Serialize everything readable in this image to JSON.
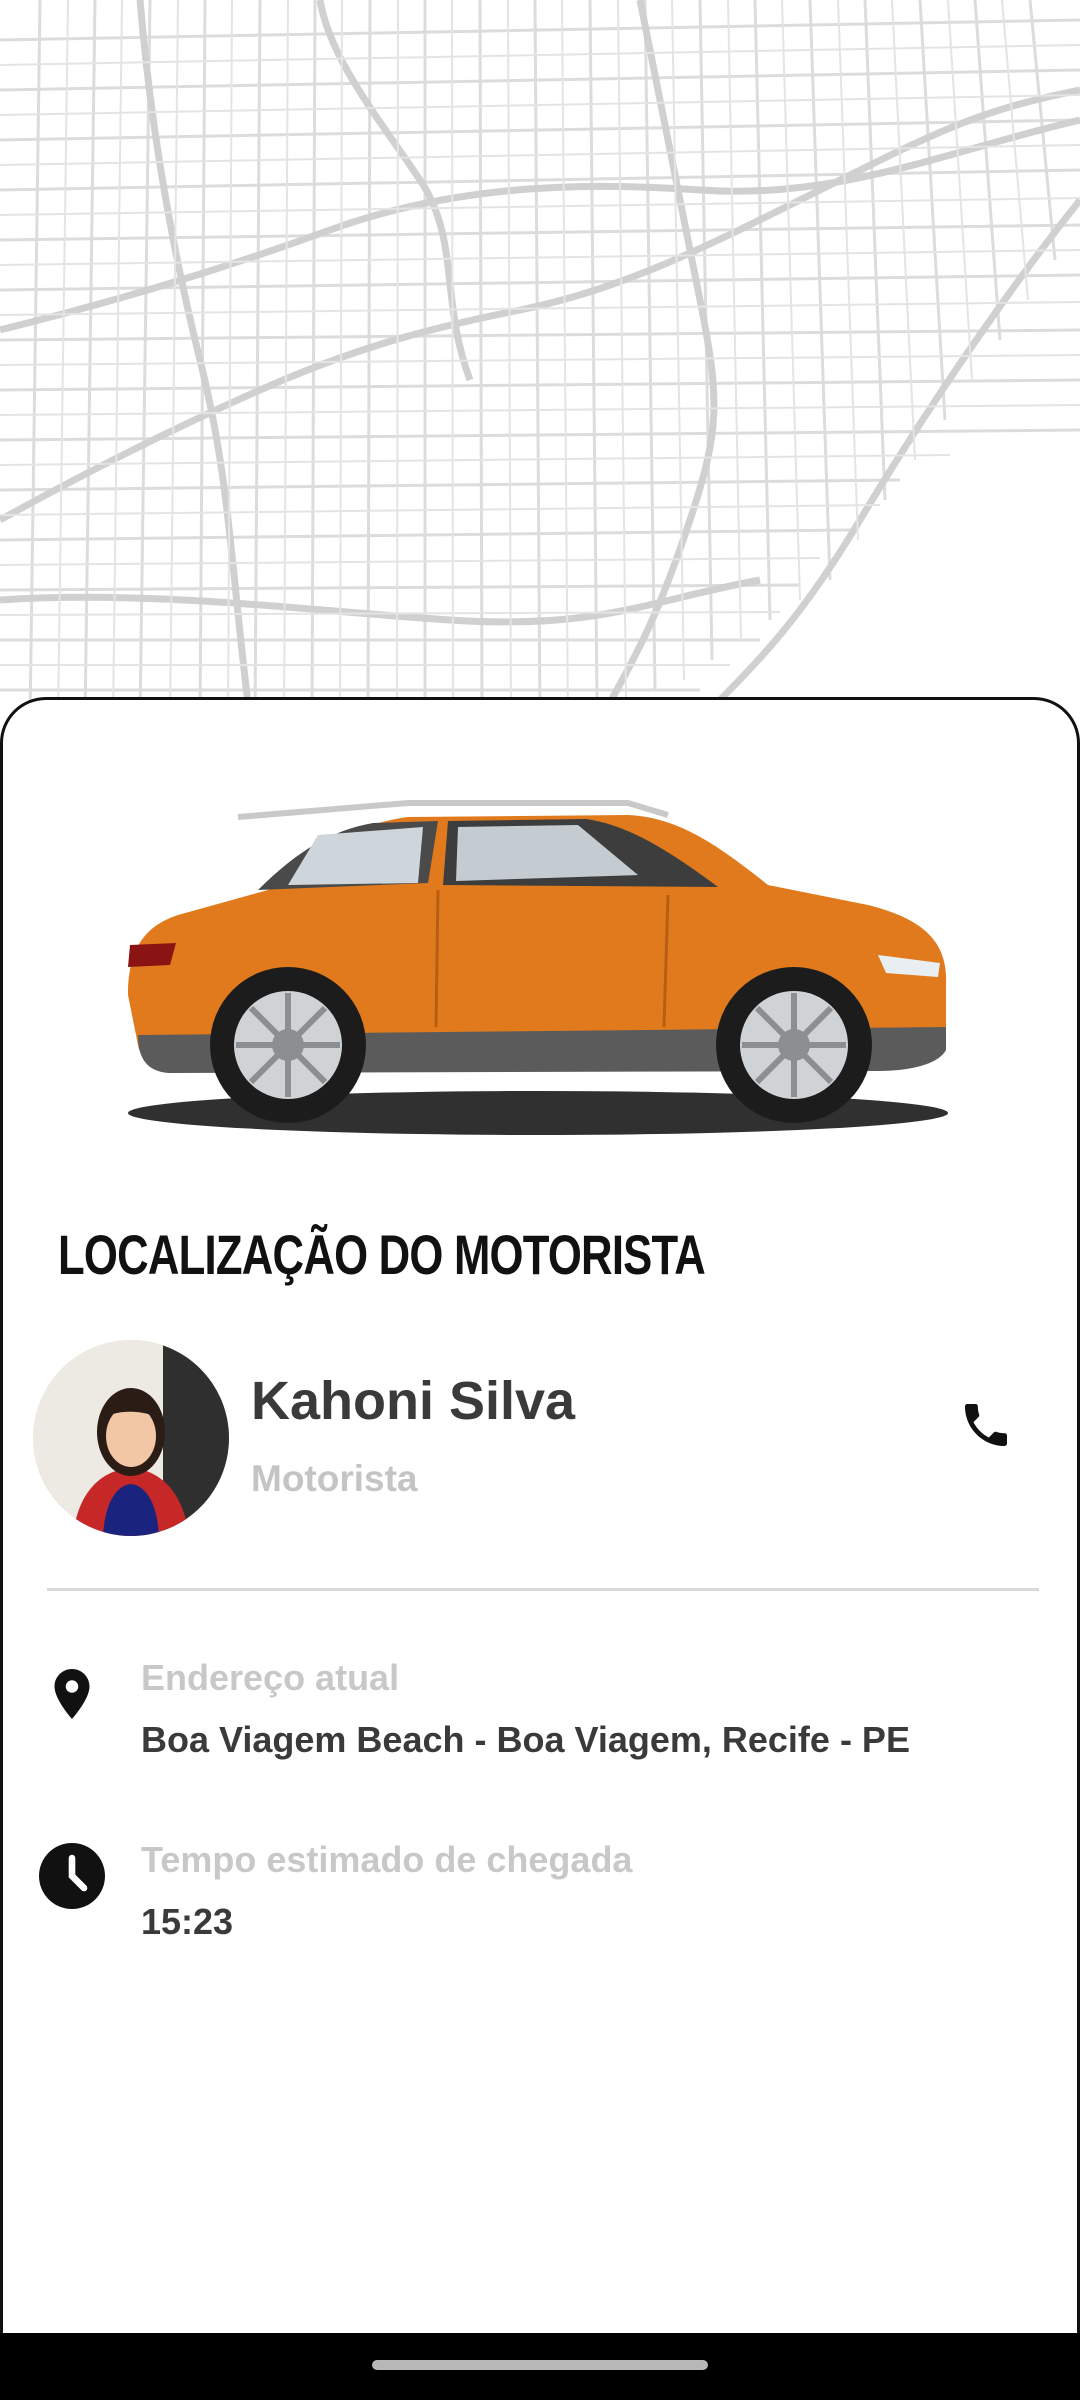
{
  "map": {
    "icon": "city-street-map"
  },
  "sheet": {
    "car_image": "orange-suv",
    "title": "LOCALIZAÇÃO DO MOTORISTA",
    "driver": {
      "name": "Kahoni Silva",
      "role": "Motorista",
      "avatar": "driver-photo",
      "call_icon": "phone-icon"
    },
    "address": {
      "icon": "location-pin-icon",
      "label": "Endereço atual",
      "value": "Boa Viagem Beach - Boa Viagem, Recife - PE"
    },
    "eta": {
      "icon": "clock-icon",
      "label": "Tempo estimado de chegada",
      "value": "15:23"
    }
  },
  "colors": {
    "car_orange": "#e07a1c",
    "text_dark": "#3a3a3a",
    "text_muted": "#c4c4c4",
    "map_lines": "#d6d6d6"
  }
}
